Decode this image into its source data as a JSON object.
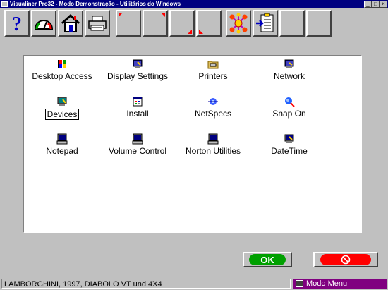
{
  "window": {
    "title": "Visualiner Pro32 - Modo Demonstração  -  Utilitários do Windows",
    "controls": [
      "_",
      "□",
      "×"
    ]
  },
  "toolbar": {
    "buttons": [
      {
        "name": "help",
        "icon": "question-mark-icon"
      },
      {
        "name": "gauge",
        "icon": "gauge-icon"
      },
      {
        "name": "home",
        "icon": "home-icon"
      },
      {
        "name": "print",
        "icon": "printer-icon"
      },
      {
        "name": "slot5",
        "icon": ""
      },
      {
        "name": "slot6",
        "icon": ""
      },
      {
        "name": "slot7",
        "icon": ""
      },
      {
        "name": "slot8",
        "icon": ""
      },
      {
        "name": "network-tool",
        "icon": "molecule-icon"
      },
      {
        "name": "clipboard",
        "icon": "clipboard-import-icon"
      },
      {
        "name": "slot11",
        "icon": ""
      },
      {
        "name": "slot12",
        "icon": ""
      }
    ]
  },
  "utilities": [
    {
      "label": "Desktop Access",
      "icon": "windows-flag-icon"
    },
    {
      "label": "Display Settings",
      "icon": "display-icon"
    },
    {
      "label": "Printers",
      "icon": "printer-folder-icon"
    },
    {
      "label": "Network",
      "icon": "network-icon"
    },
    {
      "label": "Devices",
      "icon": "devices-icon",
      "selected": true
    },
    {
      "label": "Install",
      "icon": "install-icon"
    },
    {
      "label": "NetSpecs",
      "icon": "netspecs-icon"
    },
    {
      "label": "Snap On",
      "icon": "snapon-icon"
    },
    {
      "label": "Notepad",
      "icon": "computer-icon"
    },
    {
      "label": "Volume Control",
      "icon": "computer-icon"
    },
    {
      "label": "Norton Utilities",
      "icon": "computer-icon"
    },
    {
      "label": "DateTime",
      "icon": "datetime-icon"
    }
  ],
  "buttons": {
    "ok_label": "OK",
    "cancel_icon": "no-entry-icon"
  },
  "colors": {
    "ok": "#00a000",
    "cancel": "#ff0000",
    "titlebar": "#000080",
    "mode": "#800080"
  },
  "status": {
    "vehicle": "LAMBORGHINI, 1997, DIABOLO VT und 4X4",
    "mode": "Modo Menu"
  }
}
